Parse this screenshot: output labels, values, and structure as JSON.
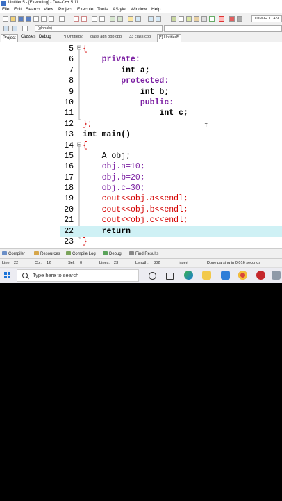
{
  "window": {
    "title": "Untitled5 - [Executing] - Dev-C++ 5.11"
  },
  "menu": [
    "File",
    "Edit",
    "Search",
    "View",
    "Project",
    "Execute",
    "Tools",
    "AStyle",
    "Window",
    "Help"
  ],
  "toolbar": {
    "compiler_select": "TDM-GCC 4.9",
    "globals_select": "(globals)"
  },
  "left_tabs": [
    "Project",
    "Classes",
    "Debug"
  ],
  "editor_tabs": [
    "[*] Untitled2",
    "class adn obb.cpp",
    "33 class.cpp",
    "[*] Untitled5"
  ],
  "code_lines": [
    {
      "n": "5",
      "text": "{"
    },
    {
      "n": "6",
      "text": "    private:"
    },
    {
      "n": "7",
      "text": "        int a;"
    },
    {
      "n": "8",
      "text": "        protected:"
    },
    {
      "n": "9",
      "text": "            int b;"
    },
    {
      "n": "10",
      "text": "            public:"
    },
    {
      "n": "11",
      "text": "                int c;"
    },
    {
      "n": "12",
      "text": "};"
    },
    {
      "n": "13",
      "text": "int main()"
    },
    {
      "n": "14",
      "text": "{"
    },
    {
      "n": "15",
      "text": "    A obj;"
    },
    {
      "n": "16",
      "text": "    obj.a=10;"
    },
    {
      "n": "17",
      "text": "    obj.b=20;"
    },
    {
      "n": "18",
      "text": "    obj.c=30;"
    },
    {
      "n": "19",
      "text": "    cout<<obj.a<<endl;"
    },
    {
      "n": "20",
      "text": "    cout<<obj.b<<endl;"
    },
    {
      "n": "21",
      "text": "    cout<<obj.c<<endl;"
    },
    {
      "n": "22",
      "text": "    return"
    },
    {
      "n": "23",
      "text": "}"
    }
  ],
  "bottom_tabs": [
    "Compiler",
    "Resources",
    "Compile Log",
    "Debug",
    "Find Results"
  ],
  "status": {
    "line_label": "Line:",
    "line_value": "22",
    "col_label": "Col:",
    "col_value": "12",
    "sel_label": "Sel:",
    "sel_value": "0",
    "lines_label": "Lines:",
    "lines_value": "23",
    "length_label": "Length:",
    "length_value": "302",
    "mode": "Insert",
    "message": "Done parsing in 0.016 seconds"
  },
  "taskbar": {
    "search_placeholder": "Type here to search",
    "icons": [
      "cortana-icon",
      "task-view-icon",
      "edge-icon",
      "file-explorer-icon",
      "mail-icon",
      "chrome-icon",
      "app-icon",
      "devcpp-icon"
    ]
  },
  "colors": {
    "highlight_line": "#cff1f5",
    "keyword_access": "#7b1fa2",
    "symbol": "#d40000"
  }
}
